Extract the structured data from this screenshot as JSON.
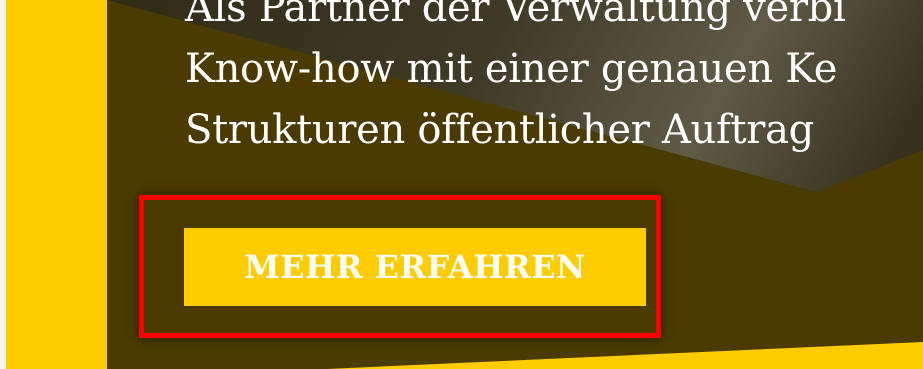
{
  "hero": {
    "text_lines": [
      "Als Partner der Verwaltung verbi",
      "Know-how mit einer genauen Ke",
      "Strukturen öffentlicher Auftrag"
    ],
    "cta_label": "MEHR ERFAHREN"
  },
  "colors": {
    "accent": "#ffcc00",
    "hero_background": "#4b3b00",
    "highlight_border": "#ff0000",
    "text": "#ffffff"
  }
}
